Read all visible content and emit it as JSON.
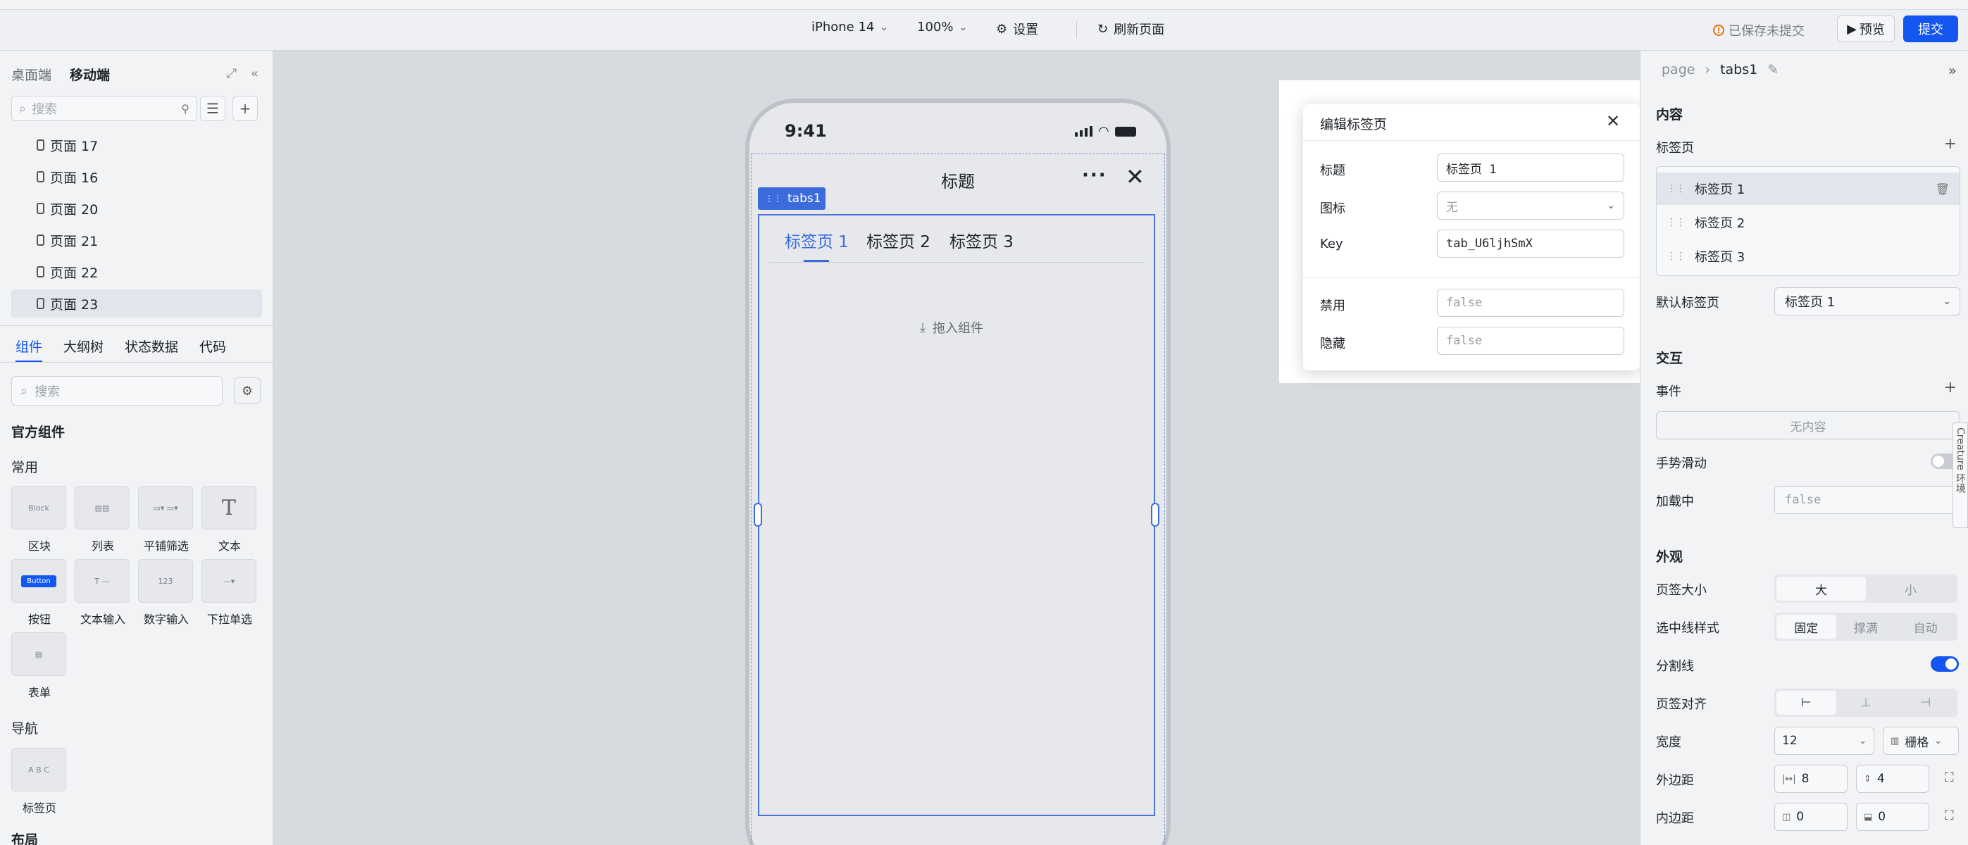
{
  "topbar": {
    "device": "iPhone 14",
    "zoom": "100%",
    "settings_label": "设置",
    "refresh_label": "刷新页面",
    "unsaved_status": "已保存未提交",
    "preview_label": "预览",
    "submit_label": "提交"
  },
  "left_panel": {
    "tab_desktop": "桌面端",
    "tab_mobile": "移动端",
    "search_placeholder": "搜索",
    "pages": [
      "页面 17",
      "页面 16",
      "页面 20",
      "页面 21",
      "页面 22",
      "页面 23"
    ],
    "selected_page": "页面 23",
    "bottom_tabs": [
      "组件",
      "大纲树",
      "状态数据",
      "代码"
    ],
    "component_search_placeholder": "搜索",
    "official_components": "官方组件",
    "group_common": "常用",
    "common_components": [
      "区块",
      "列表",
      "平铺筛选",
      "文本",
      "按钮",
      "文本输入",
      "数字输入",
      "下拉单选",
      "表单"
    ],
    "group_nav": "导航",
    "nav_components": [
      "标签页"
    ],
    "group_layout": "布局",
    "thumb_block": "Block",
    "thumb_button": "Button",
    "thumb_number": "123"
  },
  "canvas": {
    "time": "9:41",
    "nav_title": "标题",
    "component_tag": "tabs1",
    "tabs": [
      "标签页 1",
      "标签页 2",
      "标签页 3"
    ],
    "drop_hint": "拖入组件"
  },
  "modal": {
    "title": "编辑标签页",
    "fields": [
      {
        "label": "标题",
        "value": "标签页 1"
      },
      {
        "label": "图标",
        "value": "无"
      },
      {
        "label": "Key",
        "value": "tab_U6ljhSmX"
      },
      {
        "label": "禁用",
        "value": "false"
      },
      {
        "label": "隐藏",
        "value": "false"
      }
    ]
  },
  "right_panel": {
    "breadcrumb_root": "page",
    "breadcrumb_current": "tabs1",
    "section_content": "内容",
    "tabs_label": "标签页",
    "tab_items": [
      "标签页 1",
      "标签页 2",
      "标签页 3"
    ],
    "default_tab_label": "默认标签页",
    "default_tab_value": "标签页 1",
    "section_interaction": "交互",
    "events_label": "事件",
    "no_content": "无内容",
    "gesture_label": "手势滑动",
    "loading_label": "加载中",
    "loading_value": "false",
    "section_appearance": "外观",
    "tab_size_label": "页签大小",
    "tab_size_options": [
      "大",
      "小"
    ],
    "ink_style_label": "选中线样式",
    "ink_style_options": [
      "固定",
      "撑满",
      "自动"
    ],
    "divider_label": "分割线",
    "align_label": "页签对齐",
    "width_label": "宽度",
    "width_value": "12",
    "width_unit": "栅格",
    "margin_label": "外边距",
    "margin_values": [
      "8",
      "4"
    ],
    "padding_label": "内边距",
    "padding_values": [
      "0",
      "0"
    ],
    "feature_tab": "Creature 环境"
  },
  "colors": {
    "primary": "#1456f0",
    "tab_active": "#3c6bdc",
    "warning": "#e8710a"
  }
}
